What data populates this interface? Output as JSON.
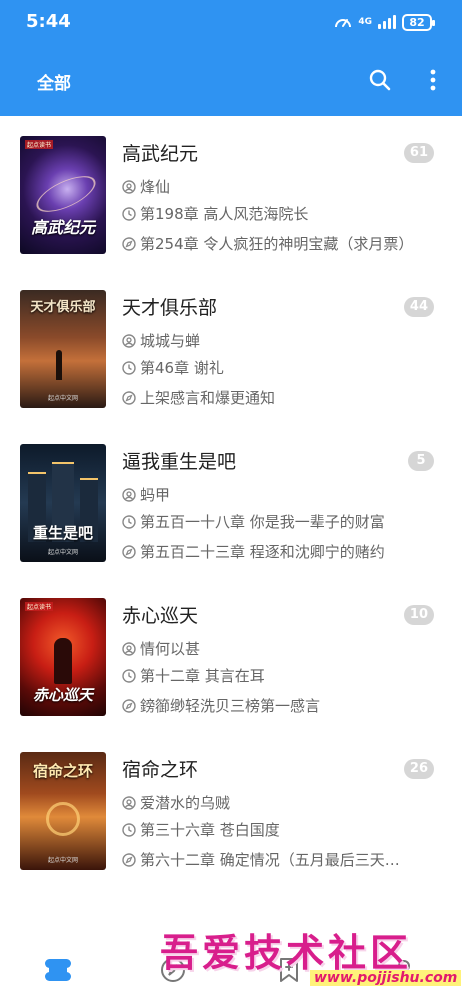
{
  "status_bar": {
    "time": "5:44",
    "network": "4G",
    "battery": "82"
  },
  "toolbar": {
    "title": "全部",
    "search_icon": "search-icon",
    "more_icon": "more-vert-icon"
  },
  "theme": {
    "primary": "#2f93f2",
    "badge": "#d6d6d6",
    "text_secondary": "#666666"
  },
  "books": [
    {
      "title": "高武纪元",
      "author": "烽仙",
      "last_read": "第198章 高人风范海院长",
      "latest": "第254章 令人疯狂的神明宝藏（求月票）",
      "unread": "61",
      "cover_title": "高武纪元",
      "cover_top": "起点读书",
      "cover_pub": ""
    },
    {
      "title": "天才俱乐部",
      "author": "城城与蝉",
      "last_read": "第46章 谢礼",
      "latest": "上架感言和爆更通知",
      "unread": "44",
      "cover_title": "天才俱乐部",
      "cover_top": "",
      "cover_pub": "起点中文网"
    },
    {
      "title": "逼我重生是吧",
      "author": "蚂甲",
      "last_read": "第五百一十八章 你是我一辈子的财富",
      "latest": "第五百二十三章 程逐和沈卿宁的赌约",
      "unread": "5",
      "cover_title": "重生是吧",
      "cover_top": "",
      "cover_pub": "起点中文网"
    },
    {
      "title": "赤心巡天",
      "author": "情何以甚",
      "last_read": "第十二章 其言在耳",
      "latest": "鎊篽缈轻洗贝三榜第一感言",
      "unread": "10",
      "cover_title": "赤心巡天",
      "cover_top": "起点读书",
      "cover_pub": ""
    },
    {
      "title": "宿命之环",
      "author": "爱潜水的乌贼",
      "last_read": "第三十六章 苍白国度",
      "latest": "第六十二章 确定情况（五月最后三天…",
      "unread": "26",
      "cover_title": "宿命之环",
      "cover_top": "",
      "cover_pub": "起点中文网"
    }
  ],
  "bottom_nav": [
    {
      "icon": "bookshelf-icon"
    },
    {
      "icon": "discover-icon"
    },
    {
      "icon": "book-source-icon"
    },
    {
      "icon": "profile-icon"
    }
  ],
  "watermark": {
    "text": "吾爱技术社区",
    "url": "www.pojjishu.com"
  }
}
